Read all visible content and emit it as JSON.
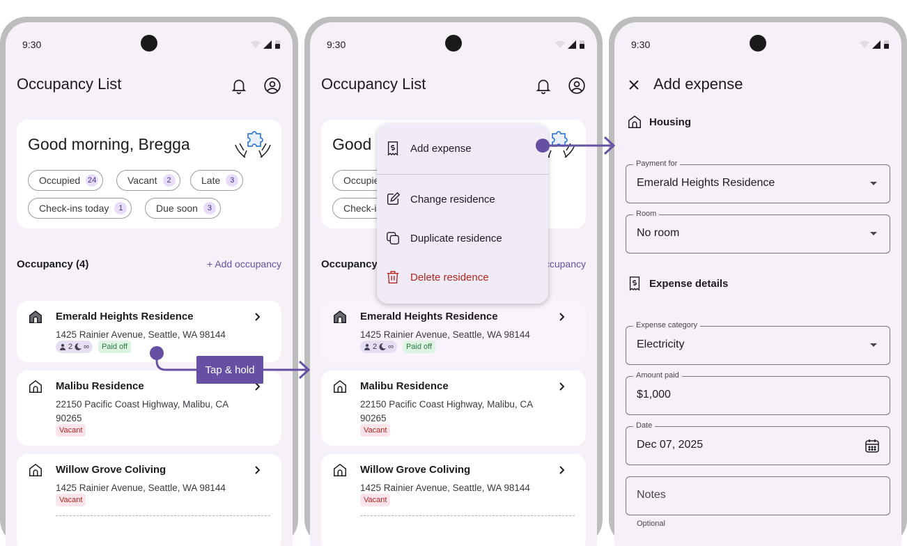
{
  "status": {
    "time": "9:30"
  },
  "list": {
    "title": "Occupancy List",
    "greeting": "Good morning, Bregga",
    "chips": [
      {
        "label": "Occupied",
        "count": "24"
      },
      {
        "label": "Vacant",
        "count": "2"
      },
      {
        "label": "Late",
        "count": "3"
      },
      {
        "label": "Check-ins today",
        "count": "1"
      },
      {
        "label": "Due soon",
        "count": "3"
      }
    ],
    "section_title": "Occupancy (4)",
    "add_link": "+ Add occupancy",
    "residences": [
      {
        "name": "Emerald Heights Residence",
        "address": "1425 Rainier Avenue, Seattle, WA 98144",
        "people": "2",
        "nights": "∞",
        "status": "Paid off"
      },
      {
        "name": "Malibu Residence",
        "address": "22150 Pacific Coast Highway, Malibu, CA 90265",
        "status": "Vacant"
      },
      {
        "name": "Willow Grove Coliving",
        "address": "1425 Rainier Avenue, Seattle, WA 98144",
        "status": "Vacant"
      }
    ]
  },
  "menu": {
    "items": [
      "Add expense",
      "Change residence",
      "Duplicate residence",
      "Delete residence"
    ]
  },
  "annotation": {
    "gesture": "Tap & hold"
  },
  "expense": {
    "title": "Add expense",
    "housing_label": "Housing",
    "payment_for": {
      "label": "Payment for",
      "value": "Emerald Heights Residence"
    },
    "room": {
      "label": "Room",
      "value": "No room"
    },
    "details_label": "Expense details",
    "category": {
      "label": "Expense category",
      "value": "Electricity"
    },
    "amount": {
      "label": "Amount paid",
      "value": "$1,000"
    },
    "date": {
      "label": "Date",
      "value": "Dec 07, 2025"
    },
    "notes": {
      "placeholder": "Notes",
      "support": "Optional"
    }
  },
  "colors": {
    "accent": "#6650a4",
    "background": "#f6f1f8",
    "danger": "#b3261e",
    "frame": "#bdbdbd"
  }
}
